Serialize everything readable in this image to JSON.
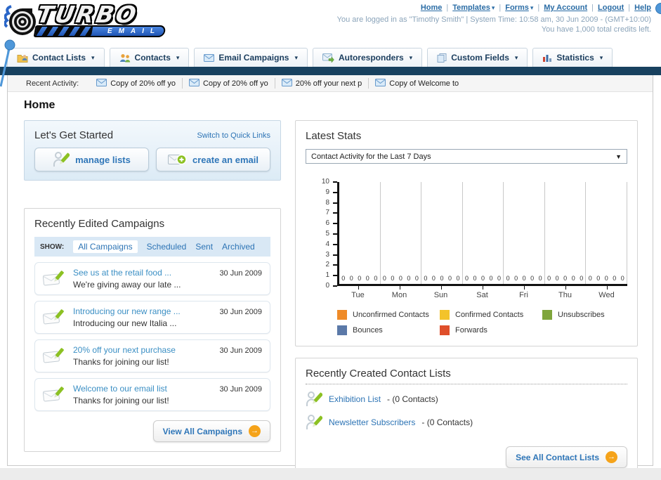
{
  "header": {
    "logo": {
      "title": "TURBO",
      "subtitle": "EMAIL"
    },
    "nav_links": [
      {
        "label": "Home",
        "dropdown": false
      },
      {
        "label": "Templates",
        "dropdown": true
      },
      {
        "label": "Forms",
        "dropdown": true
      },
      {
        "label": "My Account",
        "dropdown": false
      },
      {
        "label": "Logout",
        "dropdown": false
      },
      {
        "label": "Help",
        "dropdown": false
      }
    ],
    "status_line1": "You are logged in as \"Timothy Smith\" | System Time: 10:58 am, 30 Jun 2009 - (GMT+10:00)",
    "status_line2": "You have 1,000 total credits left."
  },
  "tabs": [
    {
      "label": "Contact Lists",
      "icon": "contact-lists-folder-icon"
    },
    {
      "label": "Contacts",
      "icon": "contacts-people-icon"
    },
    {
      "label": "Email Campaigns",
      "icon": "envelope-icon"
    },
    {
      "label": "Autoresponders",
      "icon": "envelope-arrow-icon"
    },
    {
      "label": "Custom Fields",
      "icon": "copy-pages-icon"
    },
    {
      "label": "Statistics",
      "icon": "bar-chart-icon"
    }
  ],
  "recent_activity": {
    "label": "Recent Activity:",
    "items": [
      "Copy of 20% off yo",
      "Copy of 20% off yo",
      "20% off your next p",
      "Copy of Welcome to"
    ]
  },
  "page_title": "Home",
  "get_started": {
    "title": "Let's Get Started",
    "switch_link": "Switch to Quick Links",
    "buttons": [
      {
        "label": "manage lists",
        "icon": "person-pencil-icon"
      },
      {
        "label": "create an email",
        "icon": "envelope-plus-icon"
      }
    ]
  },
  "campaigns": {
    "title": "Recently Edited Campaigns",
    "show_label": "SHOW:",
    "filters": [
      "All Campaigns",
      "Scheduled",
      "Sent",
      "Archived"
    ],
    "active_filter": "All Campaigns",
    "items": [
      {
        "title": "See us at the retail food ...",
        "subtitle": "We're giving away our late ...",
        "date": "30 Jun 2009"
      },
      {
        "title": "Introducing our new range ...",
        "subtitle": "Introducing our new Italia ...",
        "date": "30 Jun 2009"
      },
      {
        "title": "20% off your next purchase",
        "subtitle": "Thanks for joining our list!",
        "date": "30 Jun 2009"
      },
      {
        "title": "Welcome to our email list",
        "subtitle": "Thanks for joining our list!",
        "date": "30 Jun 2009"
      }
    ],
    "view_all_label": "View All Campaigns"
  },
  "latest_stats": {
    "title": "Latest Stats",
    "dropdown_value": "Contact Activity for the Last 7 Days"
  },
  "chart_data": {
    "type": "bar",
    "title": "Contact Activity for the Last 7 Days",
    "categories": [
      "Tue",
      "Mon",
      "Sun",
      "Sat",
      "Fri",
      "Thu",
      "Wed"
    ],
    "series": [
      {
        "name": "Unconfirmed Contacts",
        "color": "#EF8B28",
        "values": [
          0,
          0,
          0,
          0,
          0,
          0,
          0
        ]
      },
      {
        "name": "Confirmed Contacts",
        "color": "#F3C32A",
        "values": [
          0,
          0,
          0,
          0,
          0,
          0,
          0
        ]
      },
      {
        "name": "Unsubscribes",
        "color": "#7FA53B",
        "values": [
          0,
          0,
          0,
          0,
          0,
          0,
          0
        ]
      },
      {
        "name": "Bounces",
        "color": "#5B79A8",
        "values": [
          0,
          0,
          0,
          0,
          0,
          0,
          0
        ]
      },
      {
        "name": "Forwards",
        "color": "#DF4F2B",
        "values": [
          0,
          0,
          0,
          0,
          0,
          0,
          0
        ]
      }
    ],
    "xlabel": "",
    "ylabel": "",
    "ylim": [
      0,
      10
    ],
    "yticks": [
      0,
      1,
      2,
      3,
      4,
      5,
      6,
      7,
      8,
      9,
      10
    ],
    "grid": true,
    "legend_position": "bottom"
  },
  "contact_lists": {
    "title": "Recently Created Contact Lists",
    "items": [
      {
        "name": "Exhibition List",
        "count": "- (0 Contacts)"
      },
      {
        "name": "Newsletter Subscribers",
        "count": "- (0 Contacts)"
      }
    ],
    "see_all_label": "See All Contact Lists"
  }
}
